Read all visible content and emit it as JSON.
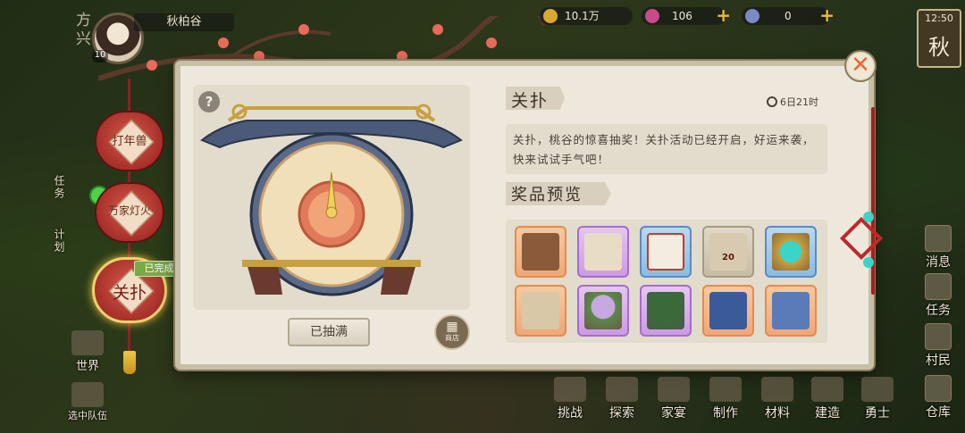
{
  "header": {
    "region": "方兴",
    "player_name": "秋柏谷",
    "player_level": "10",
    "resources": [
      {
        "icon": "coin-icon",
        "value": "10.1万",
        "color": "#d9a830"
      },
      {
        "icon": "jade-icon",
        "value": "106",
        "color": "#c84a8a"
      },
      {
        "icon": "token-icon",
        "value": "0",
        "color": "#7a8ac8"
      }
    ],
    "time": "12:50",
    "season": "秋"
  },
  "left_menu": {
    "lanterns": [
      {
        "label": "打年兽"
      },
      {
        "label": "万家灯火"
      },
      {
        "label": "关扑"
      }
    ],
    "done_tag": "已完成",
    "side_labels": [
      "任务",
      "计划"
    ]
  },
  "left_nav": [
    {
      "label": "世界",
      "icon": "world-icon"
    },
    {
      "label": "选中队伍",
      "icon": "team-icon"
    }
  ],
  "panel": {
    "help": "?",
    "draw_button": "已抽满",
    "shop_label": "商店",
    "title": "关扑",
    "timer": "6日21时",
    "description": "关扑，桃谷的惊喜抽奖！关扑活动已经开启，好运来袭，快来试试手气吧！",
    "prize_title": "奖品预览",
    "prizes": [
      {
        "quality": "orange",
        "icon": "chest-icon",
        "count": ""
      },
      {
        "quality": "purple",
        "icon": "box-icon",
        "count": ""
      },
      {
        "quality": "blue",
        "icon": "card-icon",
        "count": ""
      },
      {
        "quality": "gray",
        "icon": "ticket-icon",
        "count": "20"
      },
      {
        "quality": "blue",
        "icon": "orb-icon",
        "count": ""
      },
      {
        "quality": "orange",
        "icon": "tag-icon",
        "count": ""
      },
      {
        "quality": "purple",
        "icon": "tree-icon",
        "count": ""
      },
      {
        "quality": "purple",
        "icon": "shrub-icon",
        "count": ""
      },
      {
        "quality": "orange",
        "icon": "book-icon",
        "count": ""
      },
      {
        "quality": "orange",
        "icon": "scroll-book-icon",
        "count": ""
      }
    ]
  },
  "right_nav": [
    {
      "label": "消息",
      "icon": "message-icon"
    },
    {
      "label": "任务",
      "icon": "task-icon"
    },
    {
      "label": "村民",
      "icon": "villager-icon"
    },
    {
      "label": "仓库",
      "icon": "warehouse-icon"
    }
  ],
  "bottom_nav": [
    {
      "label": "挑战",
      "icon": "challenge-icon"
    },
    {
      "label": "探索",
      "icon": "explore-icon"
    },
    {
      "label": "家宴",
      "icon": "banquet-icon"
    },
    {
      "label": "制作",
      "icon": "craft-icon"
    },
    {
      "label": "材料",
      "icon": "material-icon"
    },
    {
      "label": "建造",
      "icon": "build-icon"
    },
    {
      "label": "勇士",
      "icon": "warrior-icon"
    }
  ],
  "colors": {
    "panel_bg": "#eee8dc",
    "accent_red": "#c02828",
    "close": "#e86a3a"
  }
}
